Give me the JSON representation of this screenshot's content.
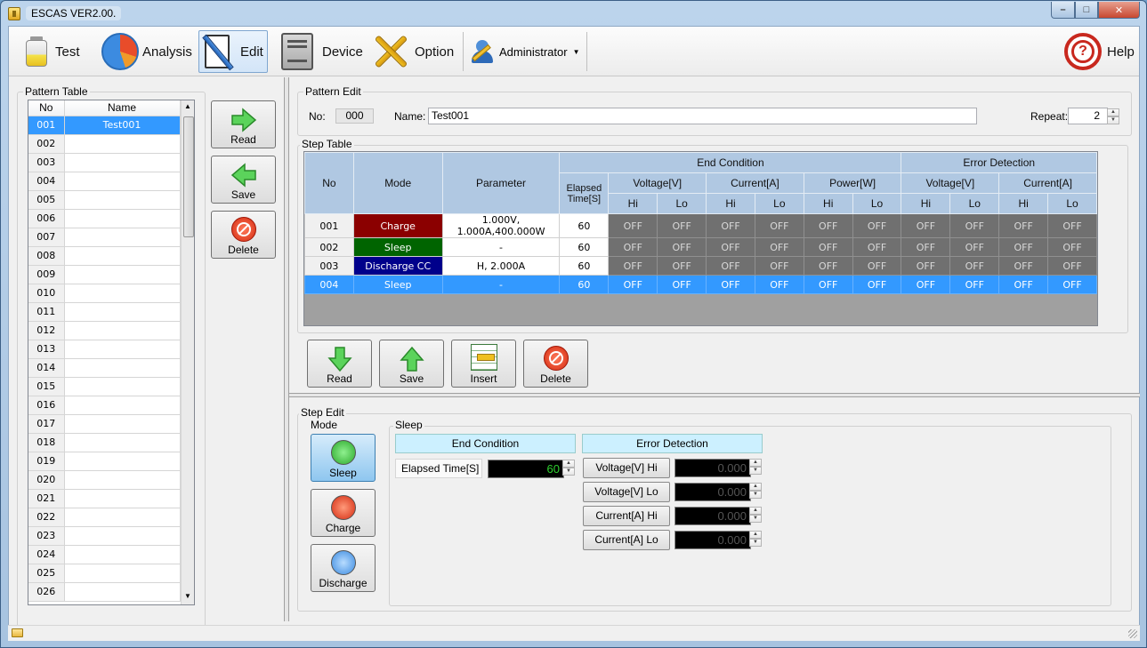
{
  "window": {
    "title": "ESCAS VER2.00."
  },
  "toolbar": {
    "test": "Test",
    "analysis": "Analysis",
    "edit": "Edit",
    "device": "Device",
    "option": "Option",
    "user": "Administrator",
    "help": "Help"
  },
  "pattern_table": {
    "title": "Pattern Table",
    "col_no": "No",
    "col_name": "Name",
    "rows": [
      {
        "no": "001",
        "name": "Test001"
      },
      {
        "no": "002",
        "name": ""
      },
      {
        "no": "003",
        "name": ""
      },
      {
        "no": "004",
        "name": ""
      },
      {
        "no": "005",
        "name": ""
      },
      {
        "no": "006",
        "name": ""
      },
      {
        "no": "007",
        "name": ""
      },
      {
        "no": "008",
        "name": ""
      },
      {
        "no": "009",
        "name": ""
      },
      {
        "no": "010",
        "name": ""
      },
      {
        "no": "011",
        "name": ""
      },
      {
        "no": "012",
        "name": ""
      },
      {
        "no": "013",
        "name": ""
      },
      {
        "no": "014",
        "name": ""
      },
      {
        "no": "015",
        "name": ""
      },
      {
        "no": "016",
        "name": ""
      },
      {
        "no": "017",
        "name": ""
      },
      {
        "no": "018",
        "name": ""
      },
      {
        "no": "019",
        "name": ""
      },
      {
        "no": "020",
        "name": ""
      },
      {
        "no": "021",
        "name": ""
      },
      {
        "no": "022",
        "name": ""
      },
      {
        "no": "023",
        "name": ""
      },
      {
        "no": "024",
        "name": ""
      },
      {
        "no": "025",
        "name": ""
      },
      {
        "no": "026",
        "name": ""
      }
    ],
    "btn_read": "Read",
    "btn_save": "Save",
    "btn_delete": "Delete"
  },
  "pattern_edit": {
    "title": "Pattern Edit",
    "no_label": "No:",
    "no_value": "000",
    "name_label": "Name:",
    "name_value": "Test001",
    "repeat_label": "Repeat:",
    "repeat_value": "2"
  },
  "step_table": {
    "title": "Step Table",
    "h_no": "No",
    "h_mode": "Mode",
    "h_param": "Parameter",
    "h_end": "End Condition",
    "h_err": "Error Detection",
    "h_elapsed": "Elapsed Time[S]",
    "h_voltage": "Voltage[V]",
    "h_current": "Current[A]",
    "h_power": "Power[W]",
    "h_hi": "Hi",
    "h_lo": "Lo",
    "rows": [
      {
        "no": "001",
        "mode": "Charge",
        "param": "1.000V, 1.000A,400.000W",
        "elapsed": "60",
        "vals": [
          "OFF",
          "OFF",
          "OFF",
          "OFF",
          "OFF",
          "OFF",
          "OFF",
          "OFF",
          "OFF",
          "OFF"
        ]
      },
      {
        "no": "002",
        "mode": "Sleep",
        "param": "-",
        "elapsed": "60",
        "vals": [
          "OFF",
          "OFF",
          "OFF",
          "OFF",
          "OFF",
          "OFF",
          "OFF",
          "OFF",
          "OFF",
          "OFF"
        ]
      },
      {
        "no": "003",
        "mode": "Discharge CC",
        "param": "H, 2.000A",
        "elapsed": "60",
        "vals": [
          "OFF",
          "OFF",
          "OFF",
          "OFF",
          "OFF",
          "OFF",
          "OFF",
          "OFF",
          "OFF",
          "OFF"
        ]
      },
      {
        "no": "004",
        "mode": "Sleep",
        "param": "-",
        "elapsed": "60",
        "vals": [
          "OFF",
          "OFF",
          "OFF",
          "OFF",
          "OFF",
          "OFF",
          "OFF",
          "OFF",
          "OFF",
          "OFF"
        ]
      }
    ],
    "btn_read": "Read",
    "btn_save": "Save",
    "btn_insert": "Insert",
    "btn_delete": "Delete"
  },
  "step_edit": {
    "title": "Step Edit",
    "mode_label": "Mode",
    "mode_sleep": "Sleep",
    "mode_charge": "Charge",
    "mode_discharge": "Discharge",
    "section_title": "Sleep",
    "end_condition": "End Condition",
    "error_detection": "Error Detection",
    "elapsed_label": "Elapsed Time[S]",
    "elapsed_value": "60",
    "v_hi": "Voltage[V] Hi",
    "v_lo": "Voltage[V] Lo",
    "c_hi": "Current[A] Hi",
    "c_lo": "Current[A] Lo",
    "v_hi_value": "0.000",
    "v_lo_value": "0.000",
    "c_hi_value": "0.000",
    "c_lo_value": "0.000"
  }
}
